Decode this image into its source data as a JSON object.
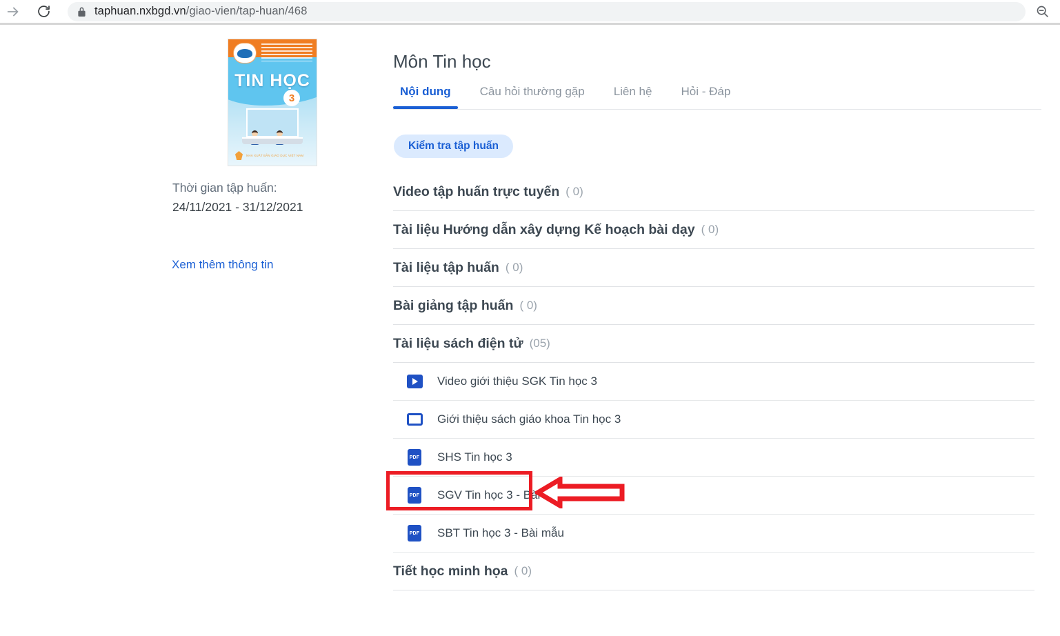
{
  "browser": {
    "forward_icon": "forward-arrow-icon",
    "reload_icon": "reload-icon",
    "lock_icon": "lock-icon",
    "zoom_out_icon": "zoom-out-icon",
    "url_host": "taphuan.nxbgd.vn",
    "url_path": "/giao-vien/tap-huan/468"
  },
  "sidebar": {
    "cover": {
      "title": "TIN HỌC",
      "grade": "3",
      "publisher": "NHÀ XUẤT BẢN GIÁO DỤC VIỆT NAM"
    },
    "time_label": "Thời gian tập huấn:",
    "time_value": "24/11/2021 - 31/12/2021",
    "more_info_link": "Xem thêm thông tin"
  },
  "header": {
    "title": "Môn Tin học"
  },
  "tabs": [
    {
      "label": "Nội dung",
      "active": true
    },
    {
      "label": "Câu hỏi thường gặp",
      "active": false
    },
    {
      "label": "Liên hệ",
      "active": false
    },
    {
      "label": "Hỏi - Đáp",
      "active": false
    }
  ],
  "badge": {
    "label": "Kiểm tra tập huấn"
  },
  "sections": [
    {
      "title": "Video tập huấn trực tuyến",
      "count": "( 0)",
      "items": []
    },
    {
      "title": "Tài liệu Hướng dẫn xây dựng Kế hoạch bài dạy",
      "count": "( 0)",
      "items": []
    },
    {
      "title": "Tài liệu tập huấn",
      "count": "( 0)",
      "items": []
    },
    {
      "title": "Bài giảng tập huấn",
      "count": "( 0)",
      "items": []
    },
    {
      "title": "Tài liệu sách điện tử",
      "count": "(05)",
      "items": [
        {
          "label": "Video giới thiệu SGK Tin học 3",
          "icon": "video-icon"
        },
        {
          "label": "Giới thiệu sách giáo khoa Tin học 3",
          "icon": "slide-icon"
        },
        {
          "label": "SHS Tin học 3",
          "icon": "pdf-icon",
          "icon_text": "PDF",
          "highlighted": true
        },
        {
          "label": "SGV Tin học 3 - Bài mẫu",
          "icon": "pdf-icon",
          "icon_text": "PDF"
        },
        {
          "label": "SBT Tin học 3 - Bài mẫu",
          "icon": "pdf-icon",
          "icon_text": "PDF"
        }
      ]
    },
    {
      "title": "Tiết học minh họa",
      "count": "( 0)",
      "items": []
    }
  ],
  "annotations": {
    "highlight_color": "#ec1c24",
    "arrow_direction": "left",
    "arrow_target": "SHS Tin học 3"
  },
  "colors": {
    "accent_blue": "#1a5fd4",
    "icon_blue": "#1f51c4",
    "badge_bg": "#dbeafe",
    "text_dark": "#3d4852",
    "text_muted": "#9aa3ac",
    "annotation_red": "#ec1c24"
  }
}
